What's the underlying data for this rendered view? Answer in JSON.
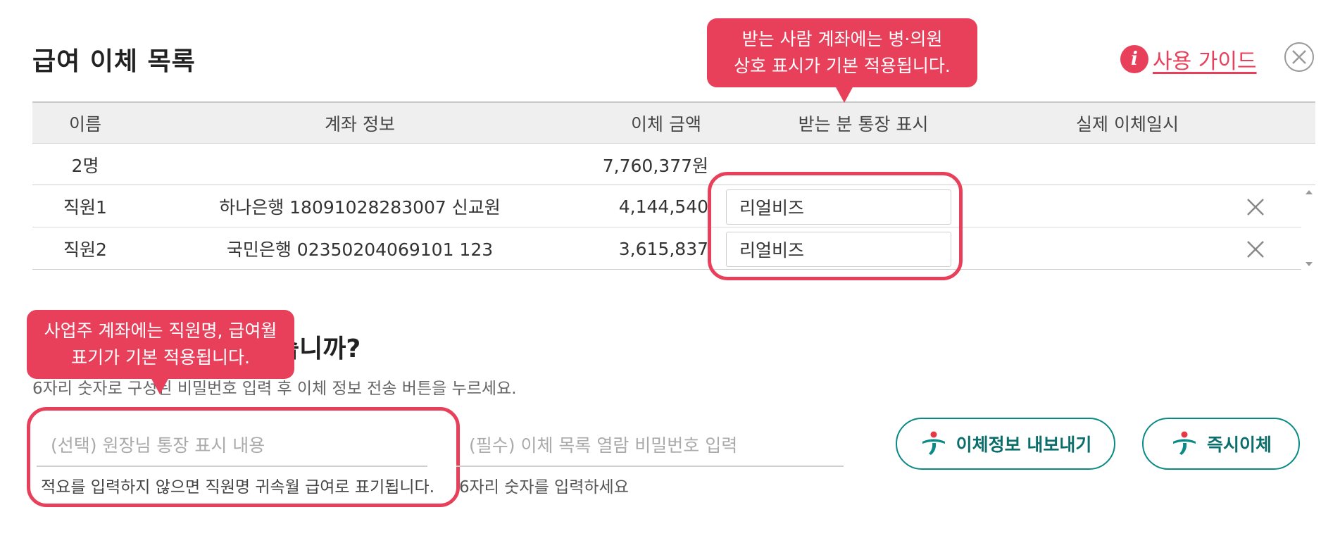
{
  "header": {
    "title": "급여 이체 목록",
    "guide_icon_glyph": "i",
    "guide_label": "사용 가이드"
  },
  "table": {
    "columns": [
      "이름",
      "계좌 정보",
      "이체 금액",
      "받는 분 통장 표시",
      "실제 이체일시"
    ],
    "summary": {
      "count": "2명",
      "total": "7,760,377원"
    },
    "rows": [
      {
        "name": "직원1",
        "account": "하나은행 18091028283007 신교원",
        "amount": "4,144,540",
        "display": "리얼비즈"
      },
      {
        "name": "직원2",
        "account": "국민은행 02350204069101 123",
        "amount": "3,615,837",
        "display": "리얼비즈"
      }
    ]
  },
  "callouts": {
    "top_line1": "받는 사람 계좌에는 병·의원",
    "top_line2": "상호 표시가 기본 적용됩니다.",
    "left_line1": "사업주 계좌에는 직원명, 급여월",
    "left_line2": "표기가 기본 적용됩니다."
  },
  "transfer": {
    "question": "습니까?",
    "instruction": "6자리 숫자로 구성된 비밀번호 입력 후 이체 정보 전송 버튼을 누르세요.",
    "memo_placeholder": "(선택) 원장님 통장 표시 내용",
    "memo_hint": "적요를 입력하지 않으면 직원명 귀속월 급여로 표기됩니다.",
    "password_placeholder": "(필수) 이체 목록 열람 비밀번호 입력",
    "password_hint": "6자리 숫자를 입력하세요"
  },
  "buttons": {
    "export_label": "이체정보 내보내기",
    "send_label": "즉시이체"
  },
  "colors": {
    "accent_red": "#e8405a",
    "teal": "#0a8a85",
    "logo_red": "#e53945",
    "header_bg": "#efefef"
  },
  "icons": {
    "guide": "info-icon",
    "close": "close-circle-icon",
    "delete": "x-icon",
    "bank_logo": "hana-bank-logo-icon"
  }
}
